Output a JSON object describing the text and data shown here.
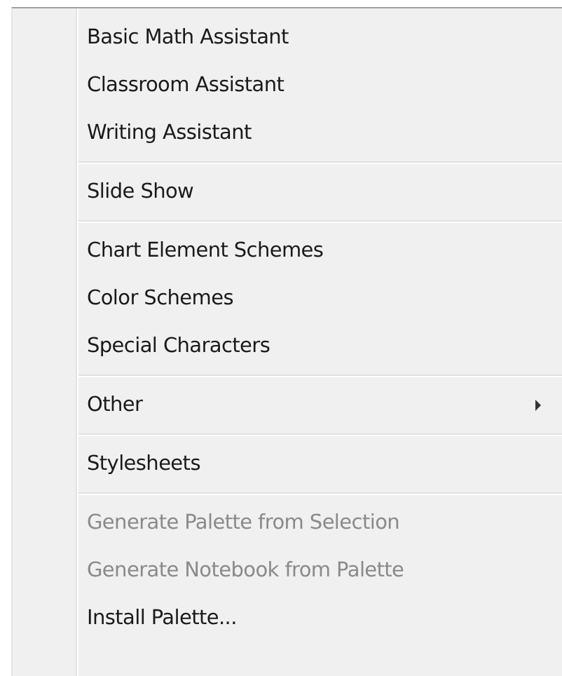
{
  "menu": {
    "groups": [
      {
        "items": [
          {
            "label": "Basic Math Assistant",
            "disabled": false,
            "submenu": false
          },
          {
            "label": "Classroom Assistant",
            "disabled": false,
            "submenu": false
          },
          {
            "label": "Writing Assistant",
            "disabled": false,
            "submenu": false
          }
        ]
      },
      {
        "items": [
          {
            "label": "Slide Show",
            "disabled": false,
            "submenu": false
          }
        ]
      },
      {
        "items": [
          {
            "label": "Chart Element Schemes",
            "disabled": false,
            "submenu": false
          },
          {
            "label": "Color Schemes",
            "disabled": false,
            "submenu": false
          },
          {
            "label": "Special Characters",
            "disabled": false,
            "submenu": false
          }
        ]
      },
      {
        "items": [
          {
            "label": "Other",
            "disabled": false,
            "submenu": true
          }
        ]
      },
      {
        "items": [
          {
            "label": "Stylesheets",
            "disabled": false,
            "submenu": false
          }
        ]
      },
      {
        "items": [
          {
            "label": "Generate Palette from Selection",
            "disabled": true,
            "submenu": false
          },
          {
            "label": "Generate Notebook from Palette",
            "disabled": true,
            "submenu": false
          },
          {
            "label": "Install Palette...",
            "disabled": false,
            "submenu": false
          }
        ]
      }
    ]
  }
}
